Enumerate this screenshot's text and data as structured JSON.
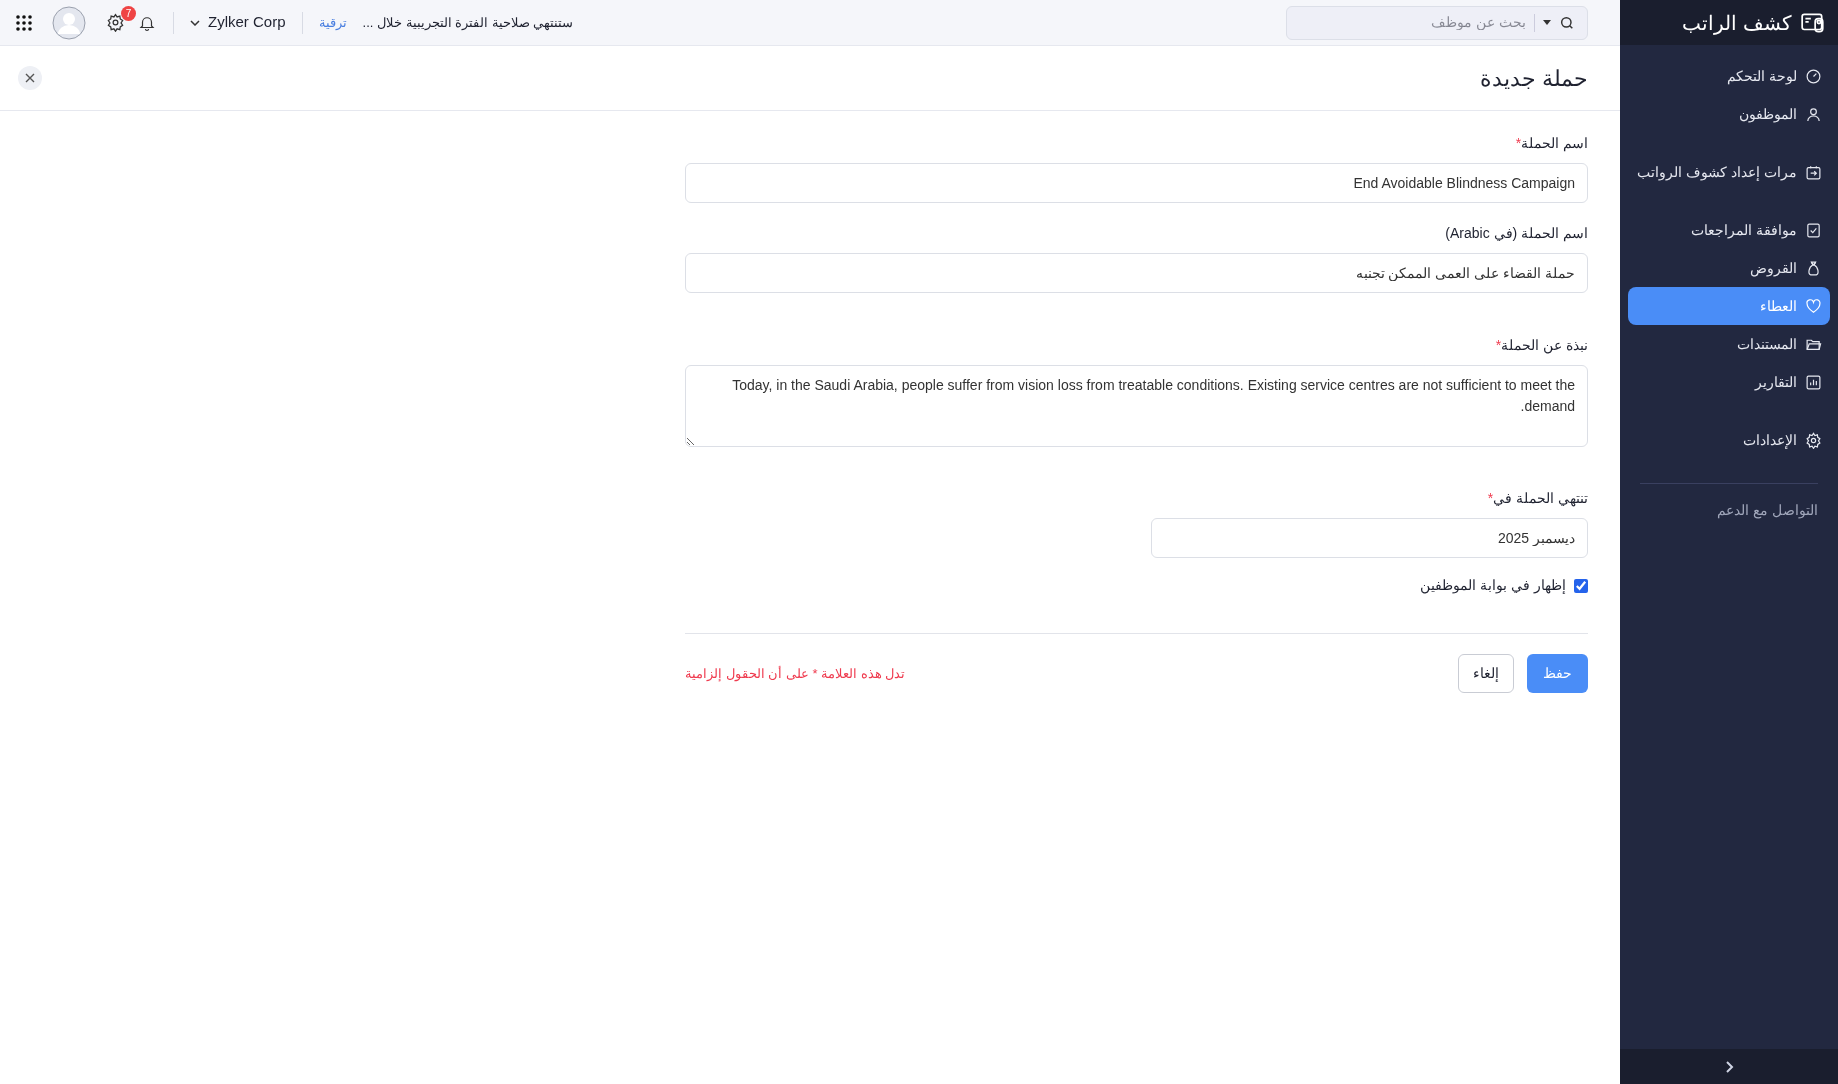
{
  "top_bar": {
    "search": {
      "placeholder": "بحث عن موظف"
    },
    "trial_notice": "ستنتهي صلاحية الفترة التجريبية خلال ...",
    "upgrade_link": "ترقية",
    "organization": "Zylker Corp",
    "notification_count": "7"
  },
  "sidebar": {
    "app_title": "كشف الراتب",
    "items": [
      {
        "label": "لوحة التحكم",
        "kind": "gauge",
        "selected": false
      },
      {
        "label": "الموظفون",
        "kind": "user",
        "selected": false
      },
      {
        "label": "مرات إعداد كشوف الرواتب",
        "kind": "payroll",
        "selected": false
      },
      {
        "label": "موافقة المراجعات",
        "kind": "approval",
        "selected": false
      },
      {
        "label": "القروض",
        "kind": "loan",
        "selected": false
      },
      {
        "label": "العطاء",
        "kind": "heart",
        "selected": true
      },
      {
        "label": "المستندات",
        "kind": "folder",
        "selected": false
      },
      {
        "label": "التقارير",
        "kind": "chart",
        "selected": false
      },
      {
        "label": "الإعدادات",
        "kind": "gear",
        "selected": false
      }
    ],
    "support_link": "التواصل مع الدعم"
  },
  "page": {
    "title": "حملة جديدة"
  },
  "form": {
    "fields": [
      {
        "label": "اسم الحملة",
        "required": true,
        "kind": "text",
        "value": "End Avoidable Blindness Campaign"
      },
      {
        "label": "اسم الحملة (في Arabic)",
        "required": false,
        "kind": "text",
        "value": "حملة القضاء على العمى الممكن تجنبه"
      },
      {
        "label": "نبذة عن الحملة",
        "required": true,
        "kind": "textarea",
        "value": "Today, in the Saudi Arabia, people suffer from vision loss from treatable conditions. Existing service centres are not sufficient to meet the demand."
      },
      {
        "label": "تنتهي الحملة في",
        "required": true,
        "kind": "date",
        "value": "ديسمبر 2025"
      }
    ],
    "show_in_portal": {
      "label": "إظهار في بوابة الموظفين",
      "checked": true
    },
    "buttons": {
      "save": "حفظ",
      "cancel": "إلغاء"
    },
    "required_mark": "*",
    "required_note": "تدل هذه العلامة * على أن الحقول إلزامية"
  }
}
